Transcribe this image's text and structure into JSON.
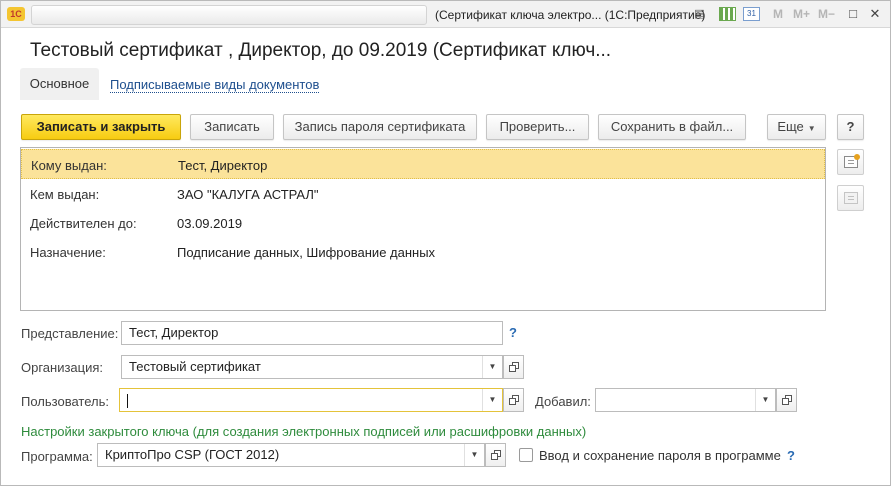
{
  "window": {
    "app_logo": "1С",
    "title": "(Сертификат ключа электро... (1С:Предприятие)",
    "icons": [
      "document-icon",
      "spreadsheet-icon",
      "calendar-icon"
    ],
    "calendar_day": "31",
    "m_labels": [
      "M",
      "M+",
      "M−"
    ],
    "controls": {
      "minimize": "_",
      "maximize": "□",
      "close": "✕"
    }
  },
  "form": {
    "title": "Тестовый сертификат , Директор, до 09.2019 (Сертификат ключ..."
  },
  "tabs": [
    {
      "label": "Основное",
      "active": true
    },
    {
      "label": "Подписываемые виды документов",
      "active": false
    }
  ],
  "toolbar": {
    "save_close": "Записать и закрыть",
    "save": "Записать",
    "save_password": "Запись пароля сертификата",
    "check": "Проверить...",
    "save_to_file": "Сохранить в файл...",
    "more": "Еще",
    "help": "?"
  },
  "certificate": {
    "rows": [
      {
        "label": "Кому выдан:",
        "value": "Тест, Директор"
      },
      {
        "label": "Кем выдан:",
        "value": "ЗАО \"КАЛУГА АСТРАЛ\""
      },
      {
        "label": "Действителен до:",
        "value": "03.09.2019"
      },
      {
        "label": "Назначение:",
        "value": "Подписание данных, Шифрование данных"
      }
    ]
  },
  "fields": {
    "presentation": {
      "label": "Представление:",
      "value": "Тест, Директор",
      "help": "?"
    },
    "organization": {
      "label": "Организация:",
      "value": "Тестовый сертификат"
    },
    "user": {
      "label": "Пользователь:",
      "value": ""
    },
    "added_by": {
      "label": "Добавил:",
      "value": ""
    },
    "private_key_section": "Настройки закрытого ключа (для создания электронных подписей или расшифровки данных)",
    "program": {
      "label": "Программа:",
      "value": "КриптоПро CSP (ГОСТ 2012)"
    },
    "save_password_checkbox": {
      "label": "Ввод и сохранение пароля в программе",
      "checked": false,
      "help": "?"
    }
  },
  "colors": {
    "accent_yellow": "#f7cc11",
    "selected_row": "#fbe39a",
    "link_blue": "#1e4f8e",
    "section_green": "#2e8b3c"
  }
}
